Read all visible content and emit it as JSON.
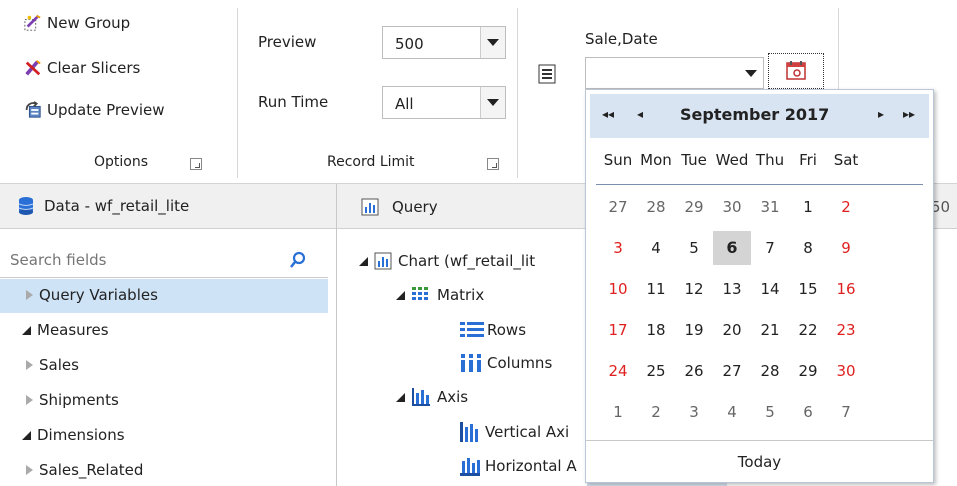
{
  "ribbon": {
    "options": {
      "new_group": "New Group",
      "clear_slicers": "Clear Slicers",
      "update_preview": "Update Preview",
      "title": "Options"
    },
    "record_limit": {
      "preview_label": "Preview",
      "preview_value": "500",
      "runtime_label": "Run Time",
      "runtime_value": "All",
      "title": "Record Limit"
    },
    "slicer": {
      "label": "Sale,Date",
      "value": ""
    }
  },
  "data_panel": {
    "title": "Data - wf_retail_lite",
    "search_placeholder": "Search fields",
    "items": [
      {
        "label": "Query Variables",
        "state": "collapsed",
        "selected": true
      },
      {
        "label": "Measures",
        "state": "expanded"
      },
      {
        "label": "Sales",
        "state": "collapsed"
      },
      {
        "label": "Shipments",
        "state": "collapsed"
      },
      {
        "label": "Dimensions",
        "state": "expanded"
      },
      {
        "label": "Sales_Related",
        "state": "collapsed"
      }
    ]
  },
  "query_panel": {
    "title": "Query",
    "overflow_text": "50",
    "tree": {
      "chart": "Chart (wf_retail_lit",
      "matrix": "Matrix",
      "rows": "Rows",
      "columns": "Columns",
      "axis": "Axis",
      "vertical_axis": "Vertical Axi",
      "horizontal_axis": "Horizontal A"
    }
  },
  "calendar": {
    "month_title": "September 2017",
    "nav": {
      "prev_year": "◂◂",
      "prev_month": "◂",
      "next_month": "▸",
      "next_year": "▸▸"
    },
    "weekdays": [
      "Sun",
      "Mon",
      "Tue",
      "Wed",
      "Thu",
      "Fri",
      "Sat"
    ],
    "weeks": [
      [
        "27",
        "28",
        "29",
        "30",
        "31",
        "1",
        "2"
      ],
      [
        "3",
        "4",
        "5",
        "6",
        "7",
        "8",
        "9"
      ],
      [
        "10",
        "11",
        "12",
        "13",
        "14",
        "15",
        "16"
      ],
      [
        "17",
        "18",
        "19",
        "20",
        "21",
        "22",
        "23"
      ],
      [
        "24",
        "25",
        "26",
        "27",
        "28",
        "29",
        "30"
      ],
      [
        "1",
        "2",
        "3",
        "4",
        "5",
        "6",
        "7"
      ]
    ],
    "selected_day": "6",
    "today_label": "Today",
    "colors": {
      "weekend": "#e02020",
      "other_month": "#666666",
      "header_bg": "#d9e4f2",
      "selected_bg": "#d4d4d4"
    }
  }
}
